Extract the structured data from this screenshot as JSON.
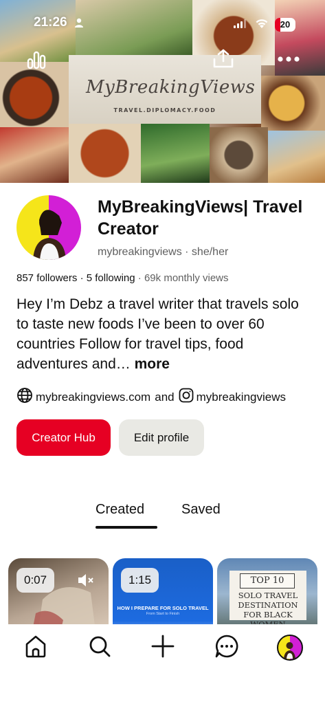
{
  "status_bar": {
    "time": "21:26",
    "battery": "20"
  },
  "banner": {
    "logo_text": "MyBreakingViews",
    "logo_subtitle": "TRAVEL.DIPLOMACY.FOOD"
  },
  "profile": {
    "display_name": "MyBreakingViews| Travel Creator",
    "handle": "mybreakingviews · she/her",
    "followers": "857 followers",
    "separator": "·",
    "following": "5 following",
    "monthly_views": "69k monthly views",
    "bio": "Hey I’m Debz a travel writer that travels solo to taste new foods  I’ve been to over 60 countries   Follow for travel tips, food adventures and…",
    "bio_more": "more",
    "website": "mybreakingviews.com",
    "links_joiner": "and",
    "instagram": "mybreakingviews"
  },
  "buttons": {
    "creator_hub": "Creator Hub",
    "edit_profile": "Edit profile"
  },
  "tabs": {
    "created": "Created",
    "saved": "Saved",
    "active": "created"
  },
  "pins": [
    {
      "duration": "0:07",
      "muted": true
    },
    {
      "duration": "1:15",
      "caption": "HOW I PREPARE FOR SOLO TRAVEL",
      "sub": "From Start to Finish"
    },
    {
      "title": "TOP 10",
      "text": "SOLO TRAVEL DESTINATION FOR BLACK WOMEN"
    }
  ],
  "colors": {
    "accent": "#e60023",
    "secondary_button": "#e9e9e4",
    "muted_text": "#5f5f5f"
  },
  "icons": {
    "status": [
      "person-icon",
      "signal-icon",
      "wifi-icon"
    ],
    "banner": [
      "stats-icon",
      "share-icon",
      "more-icon"
    ],
    "links": [
      "globe-icon",
      "instagram-icon"
    ],
    "nav": [
      "home-icon",
      "search-icon",
      "plus-icon",
      "messages-icon",
      "profile-avatar"
    ]
  }
}
